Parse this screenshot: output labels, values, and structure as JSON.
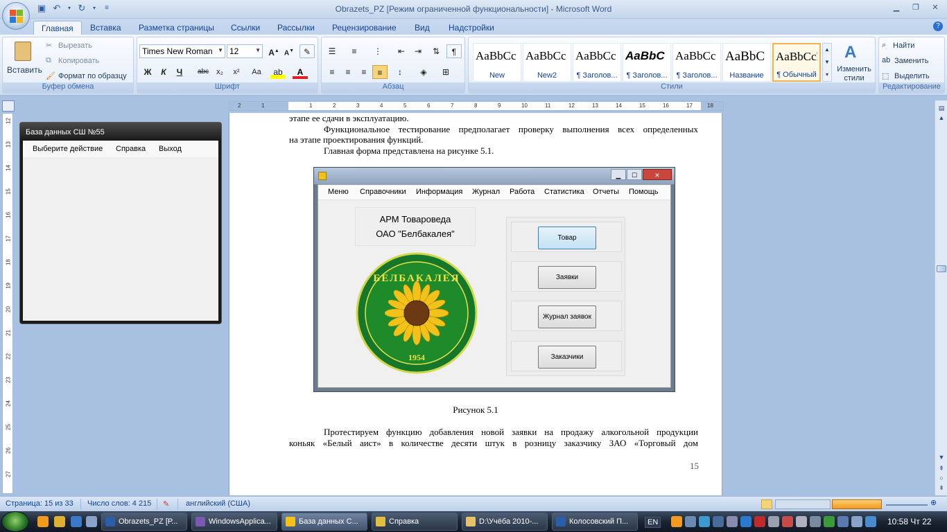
{
  "window": {
    "title": "Obrazets_PZ [Режим ограниченной функциональности] - Microsoft Word"
  },
  "tabs": [
    "Главная",
    "Вставка",
    "Разметка страницы",
    "Ссылки",
    "Рассылки",
    "Рецензирование",
    "Вид",
    "Надстройки"
  ],
  "clipboard": {
    "paste": "Вставить",
    "cut": "Вырезать",
    "copy": "Копировать",
    "format_painter": "Формат по образцу",
    "label": "Буфер обмена"
  },
  "font": {
    "name": "Times New Roman",
    "size": "12",
    "label": "Шрифт",
    "bold": "Ж",
    "italic": "К",
    "underline": "Ч",
    "strike": "abc",
    "sub": "x₂",
    "sup": "x²",
    "case": "Aa"
  },
  "paragraph": {
    "label": "Абзац"
  },
  "styles": {
    "label": "Стили",
    "items": [
      {
        "sample": "AaBbCc",
        "name": "New"
      },
      {
        "sample": "AaBbCc",
        "name": "New2"
      },
      {
        "sample": "AaBbCc",
        "name": "¶ Заголов..."
      },
      {
        "sample": "AaBbC",
        "name": "¶ Заголов..."
      },
      {
        "sample": "AaBbCc",
        "name": "¶ Заголов..."
      },
      {
        "sample": "AaBbC",
        "name": "Название"
      },
      {
        "sample": "AaBbCcI",
        "name": "¶ Обычный"
      }
    ],
    "change": "Изменить стили"
  },
  "editing": {
    "find": "Найти",
    "replace": "Заменить",
    "select": "Выделить",
    "label": "Редактирование"
  },
  "ruler_h": [
    "2",
    "1",
    "1",
    "2",
    "3",
    "4",
    "5",
    "6",
    "7",
    "8",
    "9",
    "10",
    "11",
    "12",
    "13",
    "14",
    "15",
    "16",
    "17",
    "18"
  ],
  "ruler_v": [
    "12",
    "13",
    "14",
    "15",
    "16",
    "17",
    "18",
    "19",
    "20",
    "21",
    "22",
    "23",
    "24",
    "25",
    "26",
    "27"
  ],
  "document": {
    "line1": "этапе ее сдачи в эксплуатацию.",
    "para1a": "Функциональное тестирование предполагает проверку выполнения всех определенных",
    "para1b": "на этапе проектирования функций.",
    "para2": "Главная форма представлена на рисунке 5.1.",
    "caption": "Рисунок 5.1",
    "para3a": "Протестируем функцию добавления новой заявки на продажу алкогольной продукции",
    "para3b": "коньяк «Белый аист» в количестве десяти штук в розницу заказчику ЗАО «Торговый дом",
    "page_number": "15"
  },
  "figure": {
    "menu": [
      "Меню",
      "Справочники",
      "Информация",
      "Журнал",
      "Работа",
      "Статистика",
      "Отчеты",
      "Помощь"
    ],
    "header_line1": "АРМ Товароведа",
    "header_line2": "ОАО \"Белбакалея\"",
    "logo_text": "БЕЛБАКАЛЕЯ",
    "logo_year": "1954",
    "buttons": [
      "Товар",
      "Заявки",
      "Журнал заявок",
      "Заказчики"
    ]
  },
  "mini_window": {
    "title": "База данных СШ №55",
    "menu": [
      "Выберите действие",
      "Справка",
      "Выход"
    ]
  },
  "status": {
    "page": "Страница: 15 из 33",
    "words": "Число слов: 4 215",
    "lang": "английский (США)"
  },
  "taskbar": {
    "tasks": [
      "Obrazets_PZ [Р...",
      "WindowsApplica...",
      "База данных С...",
      "Справка",
      "D:\\Учёба 2010-...",
      "Колосовский П..."
    ],
    "lang": "EN",
    "clock": "10:58 Чт 22"
  },
  "colors": {
    "accent": "#15428b",
    "ribbon": "#dde8f5",
    "taskbar": "#1b2533",
    "logo_green": "#1f8a2a",
    "logo_yellow": "#f2c21b"
  }
}
